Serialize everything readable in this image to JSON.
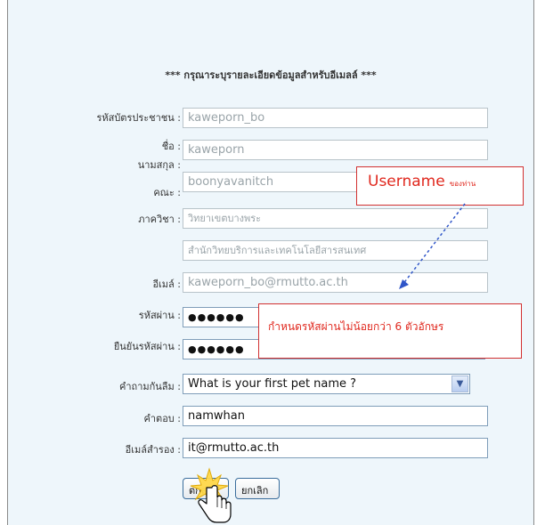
{
  "heading": "*** กรุณาระบุรายละเอียดข้อมูลสำหรับอีเมลล์ ***",
  "fields": {
    "national_id": {
      "label": "รหัสบัตรประชาชน :",
      "value": "kaweporn_bo"
    },
    "first_name": {
      "label": "ชื่อ :",
      "value": "kaweporn"
    },
    "last_name": {
      "label": "นามสกุล :",
      "value": "boonyavanitch"
    },
    "faculty": {
      "label": "คณะ :",
      "value": "วิทยาเขตบางพระ"
    },
    "department": {
      "label": "ภาควิชา :",
      "value": "สำนักวิทยบริการและเทคโนโลยีสารสนเทศ"
    },
    "email": {
      "label": "อีเมล์ :",
      "value": "kaweporn_bo@rmutto.ac.th"
    },
    "password": {
      "label": "รหัสผ่าน :",
      "value": "●●●●●●"
    },
    "confirm_password": {
      "label": "ยืนยันรหัสผ่าน :",
      "value": "●●●●●●"
    },
    "security_question": {
      "label": "คำถามกันลืม :",
      "value": "What is your first pet name ?"
    },
    "answer": {
      "label": "คำตอบ :",
      "value": "namwhan"
    },
    "backup_email": {
      "label": "อีเมล์สำรอง :",
      "value": "it@rmutto.ac.th"
    }
  },
  "buttons": {
    "submit": "ตกลง",
    "cancel": "ยกเลิก"
  },
  "callouts": {
    "username_main": "Username",
    "username_suffix": "ของท่าน",
    "password_hint": "กำหนดรหัสผ่านไม่น้อยกว่า 6 ตัวอักษร"
  },
  "colors": {
    "panel_bg": "#eef6fb",
    "callout_text": "#e0281e",
    "callout_border": "#d23030",
    "arrow": "#2f55c8"
  },
  "icons": {
    "dropdown": "chevron-down-icon",
    "cursor": "hand-cursor-icon",
    "click_burst": "click-burst-icon"
  }
}
